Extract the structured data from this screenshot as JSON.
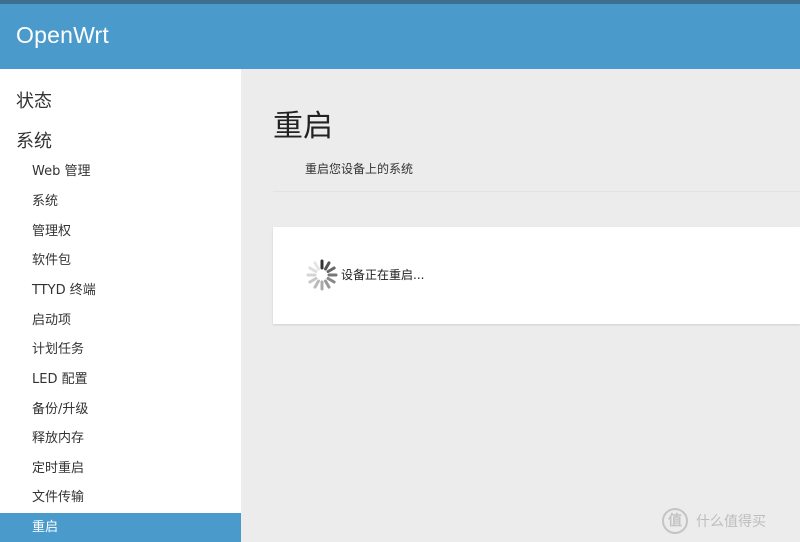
{
  "header": {
    "brand": "OpenWrt"
  },
  "sidebar": {
    "categories": [
      {
        "label": "状态"
      },
      {
        "label": "系统"
      }
    ],
    "items": [
      {
        "label": "Web 管理"
      },
      {
        "label": "系统"
      },
      {
        "label": "管理权"
      },
      {
        "label": "软件包"
      },
      {
        "label": "TTYD 终端"
      },
      {
        "label": "启动项"
      },
      {
        "label": "计划任务"
      },
      {
        "label": "LED 配置"
      },
      {
        "label": "备份/升级"
      },
      {
        "label": "释放内存"
      },
      {
        "label": "定时重启"
      },
      {
        "label": "文件传输"
      },
      {
        "label": "重启",
        "active": true
      }
    ]
  },
  "main": {
    "title": "重启",
    "description": "重启您设备上的系统",
    "status_text": "设备正在重启...",
    "spinner_icon": "loading-spinner-icon"
  },
  "watermark": {
    "logo": "值",
    "text": "什么值得买"
  },
  "colors": {
    "header_bg": "#4a9bcc",
    "top_strip": "#3d6f8e",
    "active_item_bg": "#4a9bcc",
    "page_bg": "#ececec"
  }
}
